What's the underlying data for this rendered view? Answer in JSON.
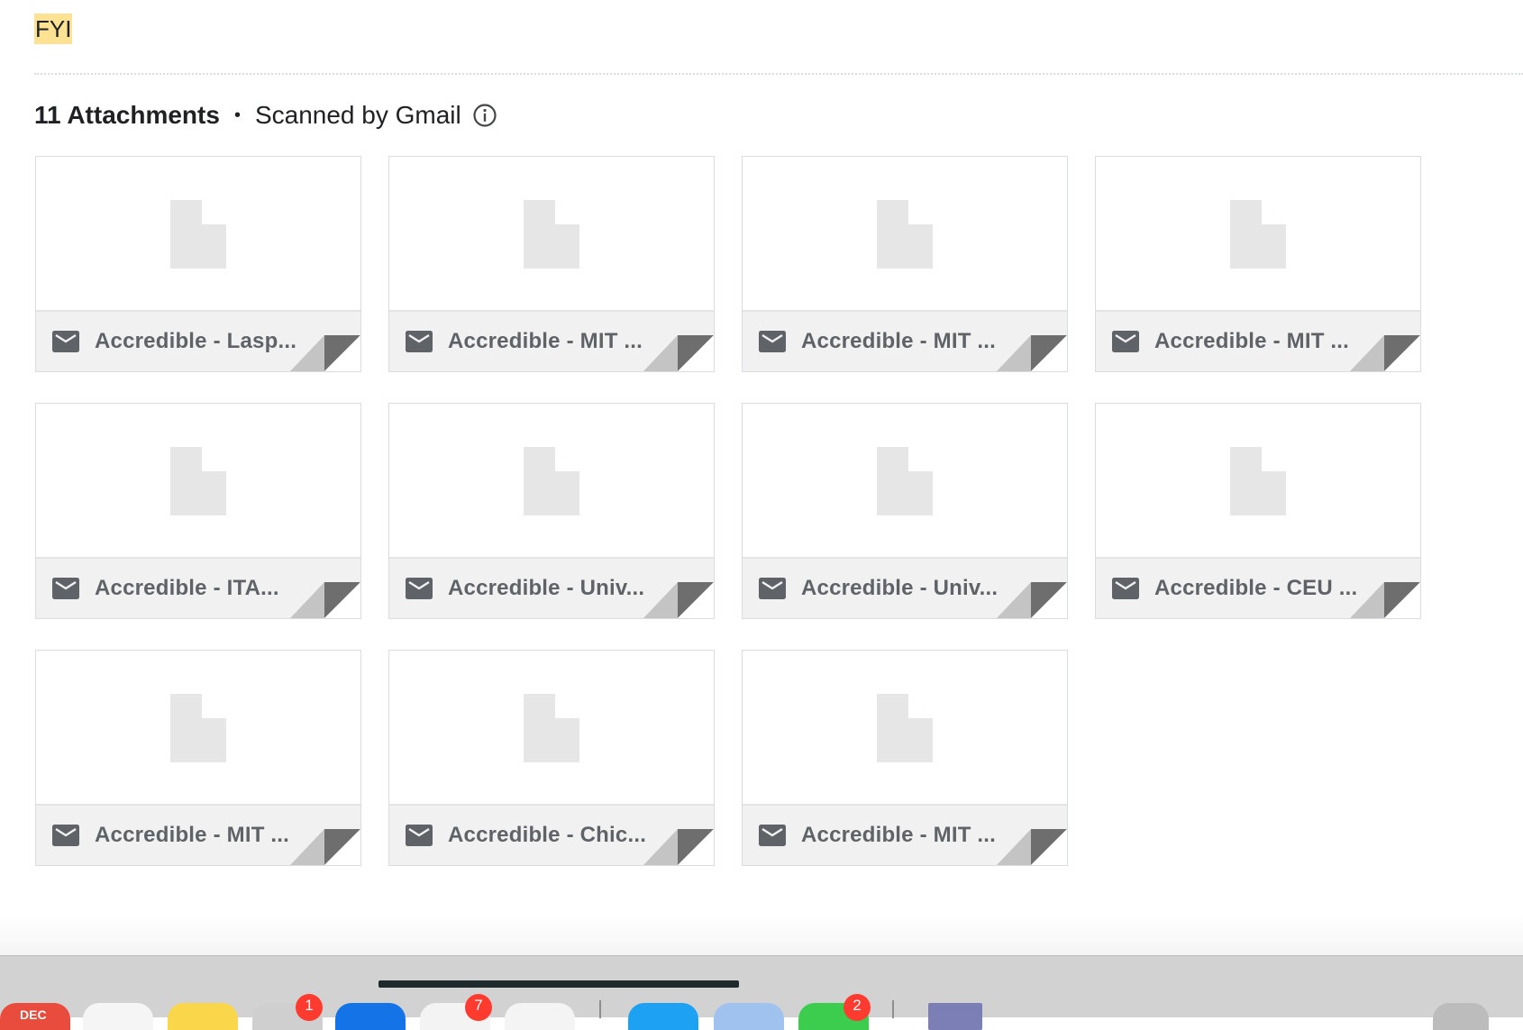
{
  "message": {
    "body_text": "FYI"
  },
  "attachments_header": {
    "count_label": "11 Attachments",
    "separator": "•",
    "scanned_label": "Scanned by Gmail",
    "info_icon": "info-icon"
  },
  "attachments": [
    {
      "name": "Accredible - Lasp...",
      "icon": "mail-icon"
    },
    {
      "name": "Accredible - MIT ...",
      "icon": "mail-icon"
    },
    {
      "name": "Accredible - MIT ...",
      "icon": "mail-icon"
    },
    {
      "name": "Accredible - MIT ...",
      "icon": "mail-icon"
    },
    {
      "name": "Accredible - ITA...",
      "icon": "mail-icon"
    },
    {
      "name": "Accredible - Univ...",
      "icon": "mail-icon"
    },
    {
      "name": "Accredible - Univ...",
      "icon": "mail-icon"
    },
    {
      "name": "Accredible - CEU ...",
      "icon": "mail-icon"
    },
    {
      "name": "Accredible - MIT ...",
      "icon": "mail-icon"
    },
    {
      "name": "Accredible - Chic...",
      "icon": "mail-icon"
    },
    {
      "name": "Accredible - MIT ...",
      "icon": "mail-icon"
    }
  ],
  "dock": {
    "calendar_label": "DEC",
    "badges": [
      "1",
      "7",
      "2"
    ]
  },
  "colors": {
    "highlight": "#fde293",
    "card_footer": "#f1f1f1",
    "filename_text": "#5f6368",
    "badge": "#ff3b30"
  }
}
